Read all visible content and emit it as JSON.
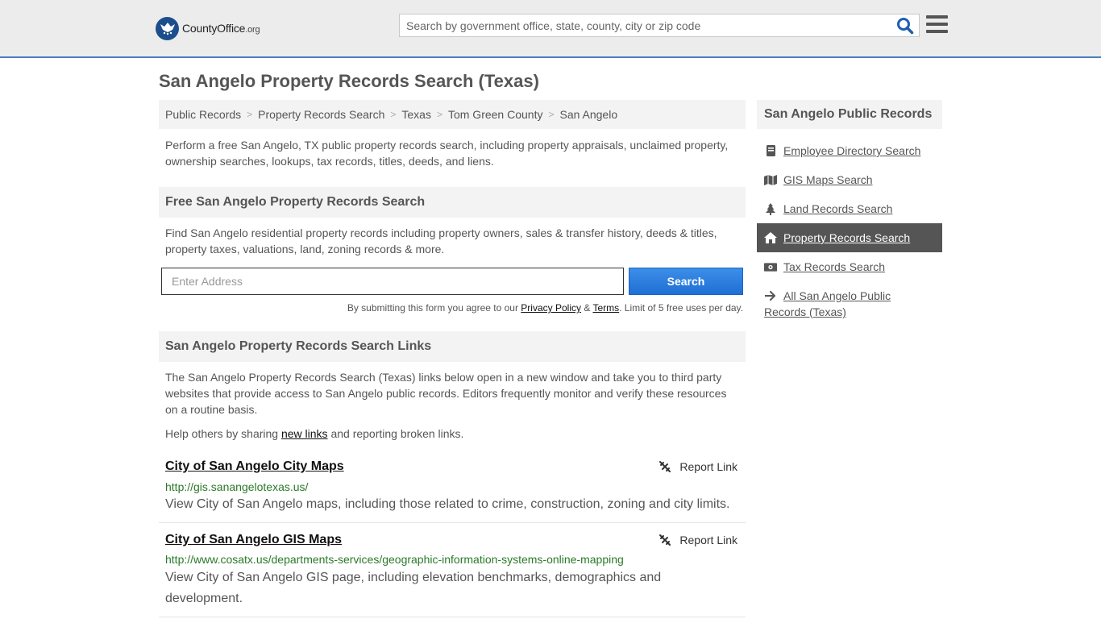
{
  "header": {
    "logo_name": "CountyOffice",
    "logo_tld": ".org",
    "search_placeholder": "Search by government office, state, county, city or zip code"
  },
  "page": {
    "title": "San Angelo Property Records Search (Texas)"
  },
  "breadcrumb": [
    "Public Records",
    "Property Records Search",
    "Texas",
    "Tom Green County",
    "San Angelo"
  ],
  "intro": "Perform a free San Angelo, TX public property records search, including property appraisals, unclaimed property, ownership searches, lookups, tax records, titles, deeds, and liens.",
  "free_search": {
    "heading": "Free San Angelo Property Records Search",
    "text": "Find San Angelo residential property records including property owners, sales & transfer history, deeds & titles, property taxes, valuations, land, zoning records & more.",
    "input_placeholder": "Enter Address",
    "button_label": "Search",
    "agree_prefix": "By submitting this form you agree to our",
    "privacy_label": "Privacy Policy",
    "amp": "&",
    "terms_label": "Terms",
    "agree_suffix": ". Limit of 5 free uses per day."
  },
  "links_section": {
    "heading": "San Angelo Property Records Search Links",
    "text": "The San Angelo Property Records Search (Texas) links below open in a new window and take you to third party websites that provide access to San Angelo public records. Editors frequently monitor and verify these resources on a routine basis.",
    "help_prefix": "Help others by sharing",
    "help_link": "new links",
    "help_suffix": "and reporting broken links.",
    "report_label": "Report Link",
    "items": [
      {
        "title": "City of San Angelo City Maps",
        "url": "http://gis.sanangelotexas.us/",
        "description": "View City of San Angelo maps, including those related to crime, construction, zoning and city limits."
      },
      {
        "title": "City of San Angelo GIS Maps",
        "url": "http://www.cosatx.us/departments-services/geographic-information-systems-online-mapping",
        "description": "View City of San Angelo GIS page, including elevation benchmarks, demographics and development."
      }
    ]
  },
  "sidebar": {
    "heading": "San Angelo Public Records",
    "items": [
      {
        "label": "Employee Directory Search",
        "icon": "book-icon"
      },
      {
        "label": "GIS Maps Search",
        "icon": "map-icon"
      },
      {
        "label": "Land Records Search",
        "icon": "tree-icon"
      },
      {
        "label": "Property Records Search",
        "icon": "home-icon"
      },
      {
        "label": "Tax Records Search",
        "icon": "money-icon"
      },
      {
        "label": "All San Angelo Public Records (Texas)",
        "icon": "arrow-right-icon"
      }
    ]
  },
  "colors": {
    "accent_blue": "#1f6fd6",
    "header_border": "#4a7fbf",
    "link_url_green": "#2a7a2a",
    "sidebar_active": "#555555"
  }
}
